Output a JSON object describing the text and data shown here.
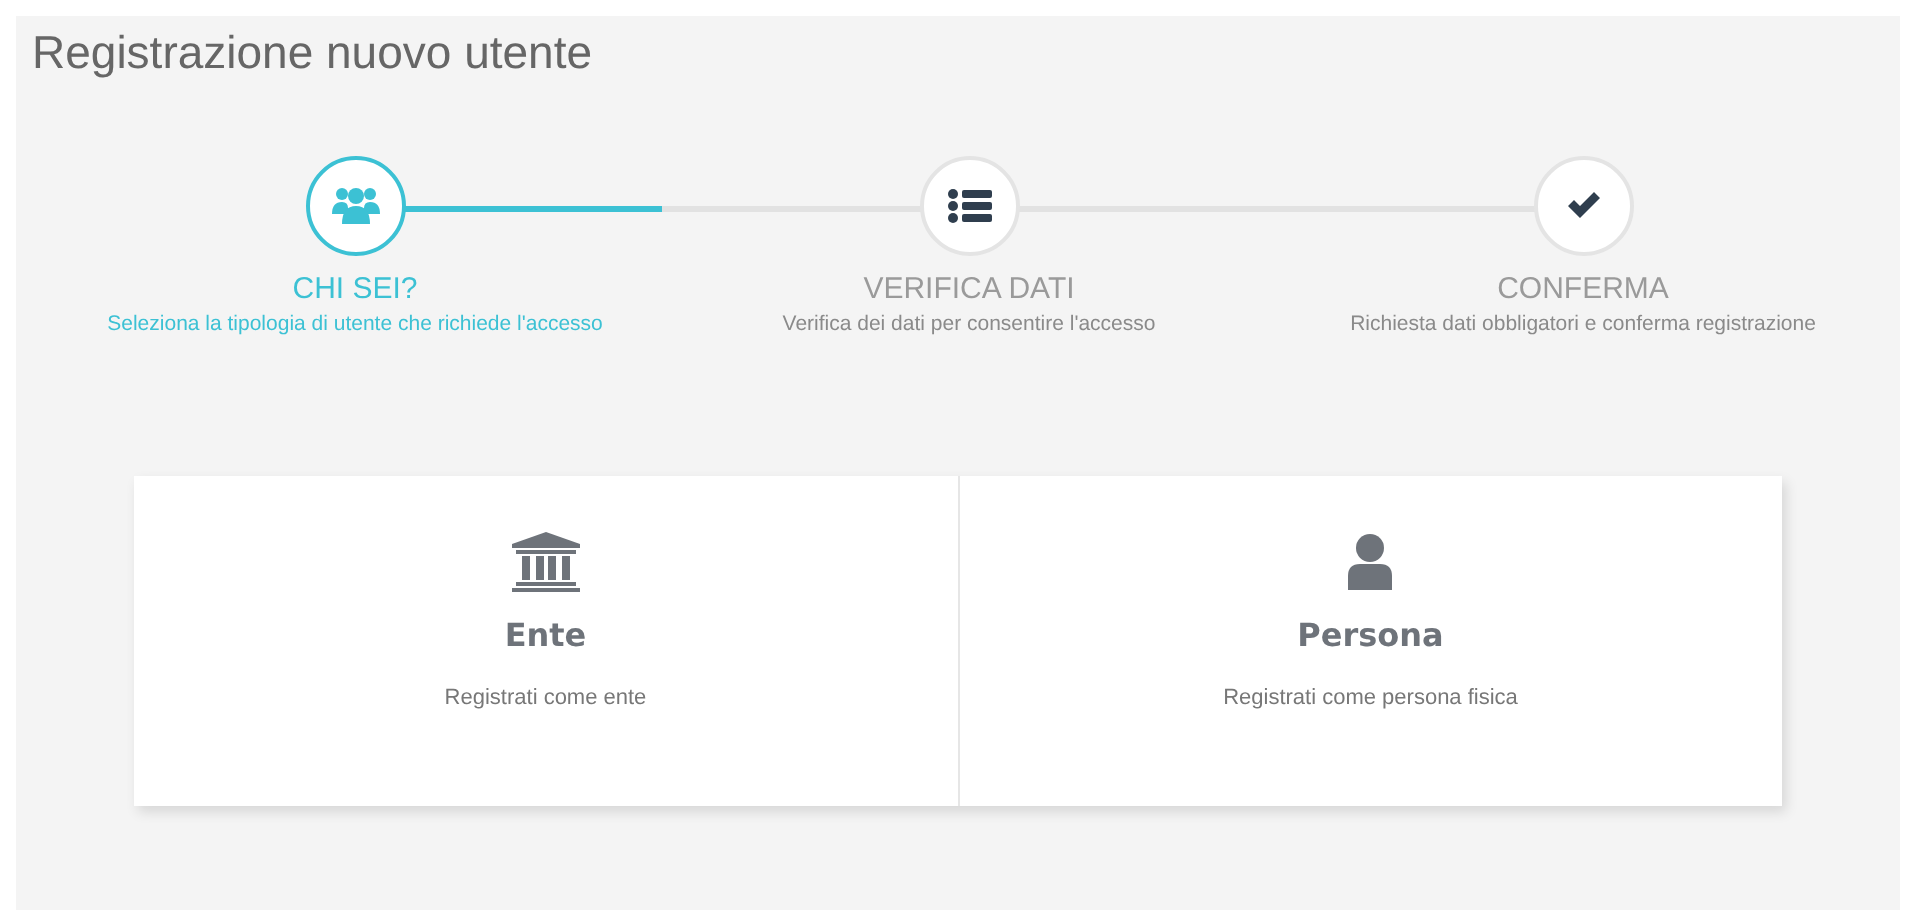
{
  "page": {
    "title": "Registrazione nuovo utente"
  },
  "progress": {
    "level": 0.25
  },
  "steps": [
    {
      "label": "CHI SEI?",
      "description": "Seleziona la tipologia di utente che richiede l'accesso",
      "selected": true
    },
    {
      "label": "VERIFICA DATI",
      "description": "Verifica dei dati per consentire l'accesso",
      "selected": false
    },
    {
      "label": "CONFERMA",
      "description": "Richiesta dati obbligatori e conferma registrazione",
      "selected": false
    }
  ],
  "options": [
    {
      "title": "Ente",
      "description": "Registrati come ente"
    },
    {
      "title": "Persona",
      "description": "Registrati come persona fisica"
    }
  ]
}
